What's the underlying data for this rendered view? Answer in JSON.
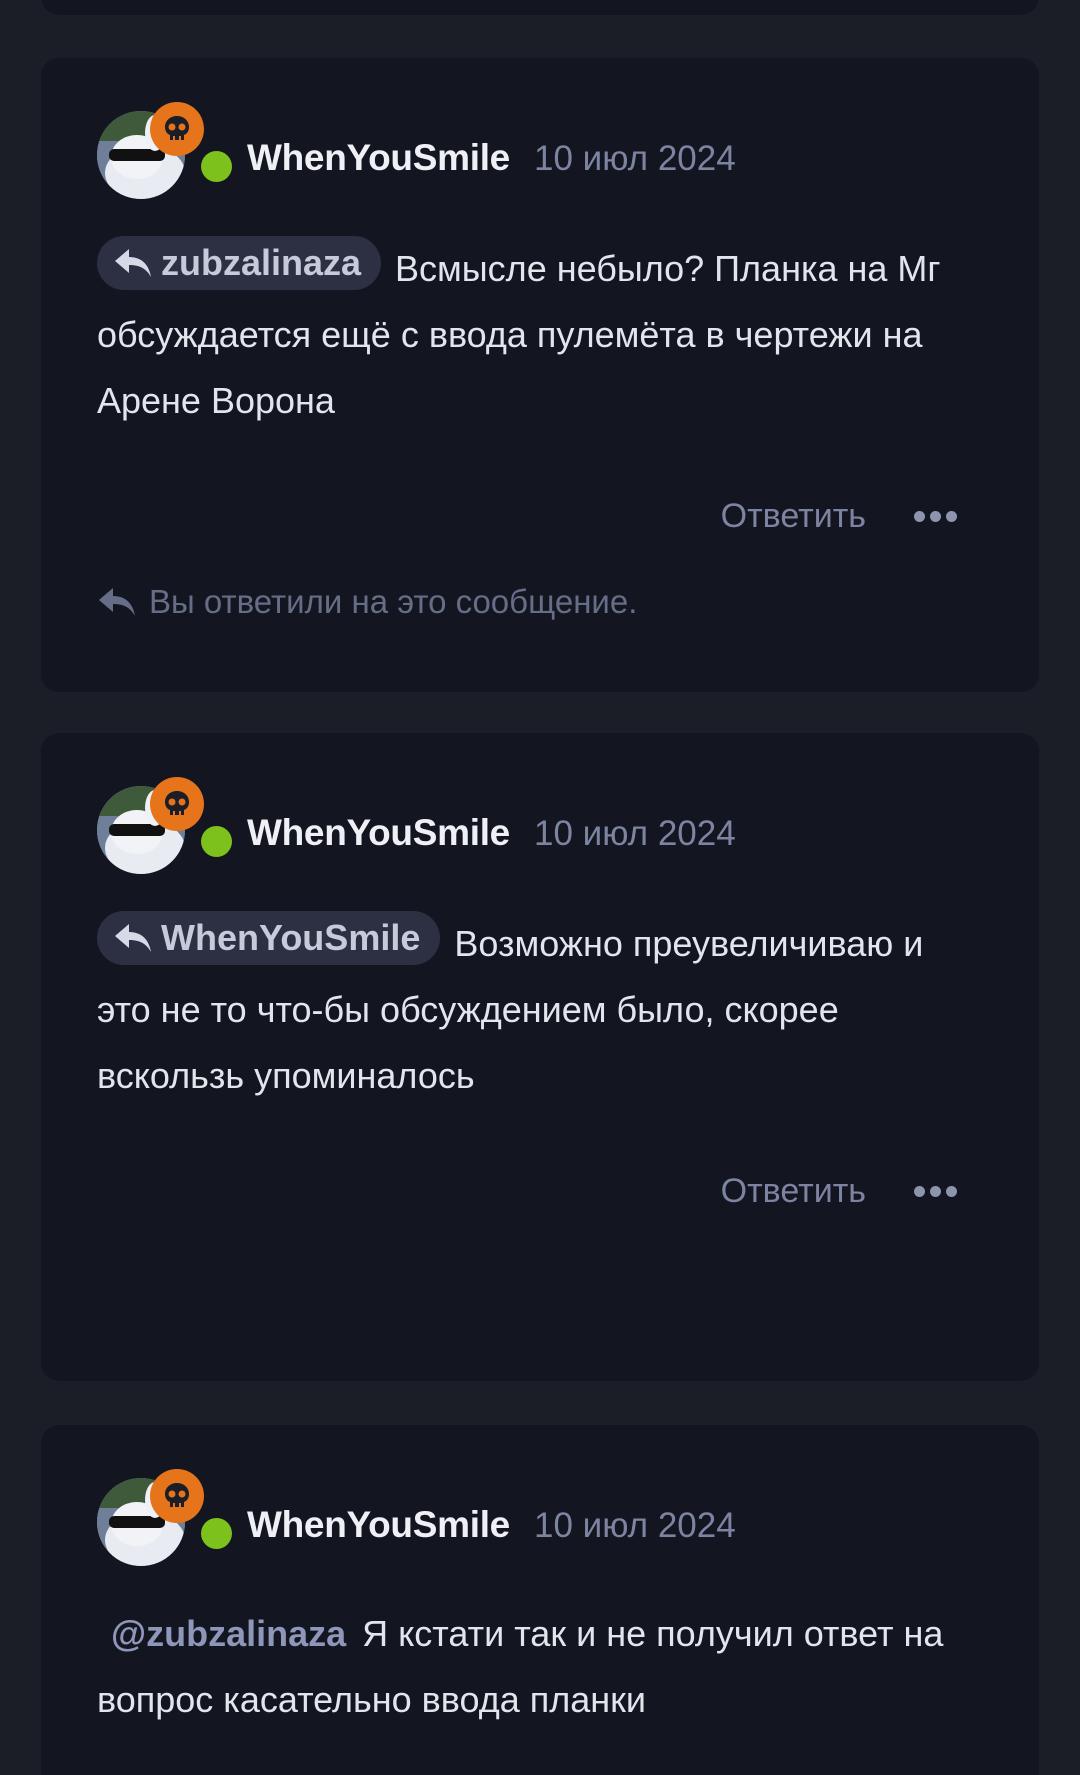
{
  "colors": {
    "background": "#1b1d27",
    "card": "#131520",
    "online": "#7dc11c",
    "badge": "#e5741b"
  },
  "posts": [
    {
      "author": "WhenYouSmile",
      "date": "10 июл 2024",
      "quote_user": "zubzalinaza",
      "text": "Всмысле небыло? Планка на Мг обсуждается ещё с ввода пулемёта в чертежи на Арене Ворона",
      "reply_label": "Ответить",
      "replied_note": "Вы ответили на это сообщение."
    },
    {
      "author": "WhenYouSmile",
      "date": "10 июл 2024",
      "quote_user": "WhenYouSmile",
      "text": "Возможно преувеличиваю и это не то что-бы обсуждением было, скорее вскользь упоминалось",
      "reply_label": "Ответить"
    },
    {
      "author": "WhenYouSmile",
      "date": "10 июл 2024",
      "mention": "@zubzalinaza",
      "text": "Я кстати так и не получил ответ на вопрос касательно ввода планки"
    }
  ],
  "icons": {
    "reply": "reply-arrow-icon",
    "badge": "skull-icon",
    "more": "more-dots-icon"
  }
}
